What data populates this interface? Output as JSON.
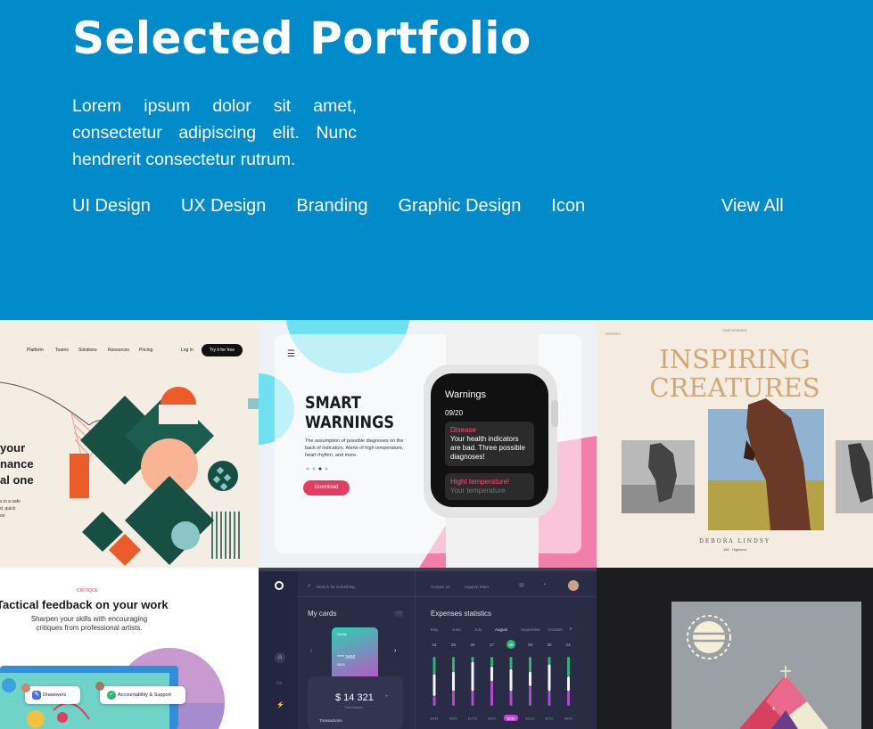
{
  "hero": {
    "title": "Selected Portfolio",
    "description": "Lorem ipsum dolor sit amet, consectetur adipiscing elit. Nunc hendrerit consectetur rutrum.",
    "filters": [
      "UI Design",
      "UX Design",
      "Branding",
      "Graphic Design",
      "Icon"
    ],
    "view_all": "View All"
  },
  "colors": {
    "hero_bg": "#028bcb",
    "accent_pink": "#e23d62",
    "green": "#2bb673"
  },
  "tile1": {
    "nav": [
      "Platform",
      "Teams",
      "Solutions",
      "Resources",
      "Pricing",
      "Log In"
    ],
    "cta": "Try it for free",
    "headline": [
      "your",
      "nance",
      "al one"
    ],
    "caption": [
      "s in a safe",
      "d, quick",
      "on"
    ]
  },
  "tile2": {
    "title_1": "SMART",
    "title_2": "WARNINGS",
    "desc": "The assumption of possible diagnoses on the back of indicators. Alerts of high temperature, heart rhythm, and more.",
    "button": "Download",
    "watch": {
      "title": "Warnings",
      "count": "09/20",
      "card1_head": "Disease",
      "card1_body": "Your health indicators are bad. Three possible diagnoses!",
      "card2_head": "Hight temperature!",
      "card2_body": "Your temperature"
    }
  },
  "tile3": {
    "tag": "OUR HORSES",
    "brand": "HORSES",
    "title_1": "INSPIRING",
    "title_2": "CREATURES",
    "name": "DEBORA LINDSY",
    "meta_1": "180",
    "meta_2": "Highland"
  },
  "tile4": {
    "tag": "CRITIQUE",
    "title": "Tactical feedback on your work",
    "subtitle": "Sharpen your skills with encouraging critiques from professional artists.",
    "pill_1": "Drawovers",
    "pill_2": "Accountability & Support"
  },
  "tile5": {
    "search": "Search for something",
    "links": [
      "Contact us",
      "Support team"
    ],
    "my_cards": "My cards",
    "card_brand": "Skrilla",
    "card_number": "**** 3456",
    "card_expiry": "08/24",
    "balance": "$ 14 321",
    "balance_label": "Total balance",
    "transactions": "Transactions",
    "expenses_title": "Expenses statistics",
    "months": [
      "May",
      "June",
      "July",
      "August",
      "September",
      "October"
    ],
    "days": [
      "24",
      "25",
      "26",
      "27",
      "28",
      "29",
      "30",
      "01"
    ],
    "selected_day": "28",
    "values": [
      "$348",
      "$903",
      "$1720",
      "$450",
      "$236",
      "$1126",
      "$719",
      "$430"
    ],
    "selected_value": "$236",
    "bars": [
      {
        "green": 0.35,
        "white": 0.45,
        "purple": 0.2
      },
      {
        "green": 0.3,
        "white": 0.4,
        "purple": 0.3
      },
      {
        "green": 0.1,
        "white": 0.6,
        "purple": 0.3
      },
      {
        "green": 0.2,
        "white": 0.3,
        "purple": 0.5
      },
      {
        "green": 0.25,
        "white": 0.45,
        "purple": 0.3
      },
      {
        "green": 0.3,
        "white": 0.3,
        "purple": 0.4
      },
      {
        "green": 0.15,
        "white": 0.55,
        "purple": 0.3
      },
      {
        "green": 0.4,
        "white": 0.3,
        "purple": 0.3
      }
    ]
  },
  "tile6": {}
}
